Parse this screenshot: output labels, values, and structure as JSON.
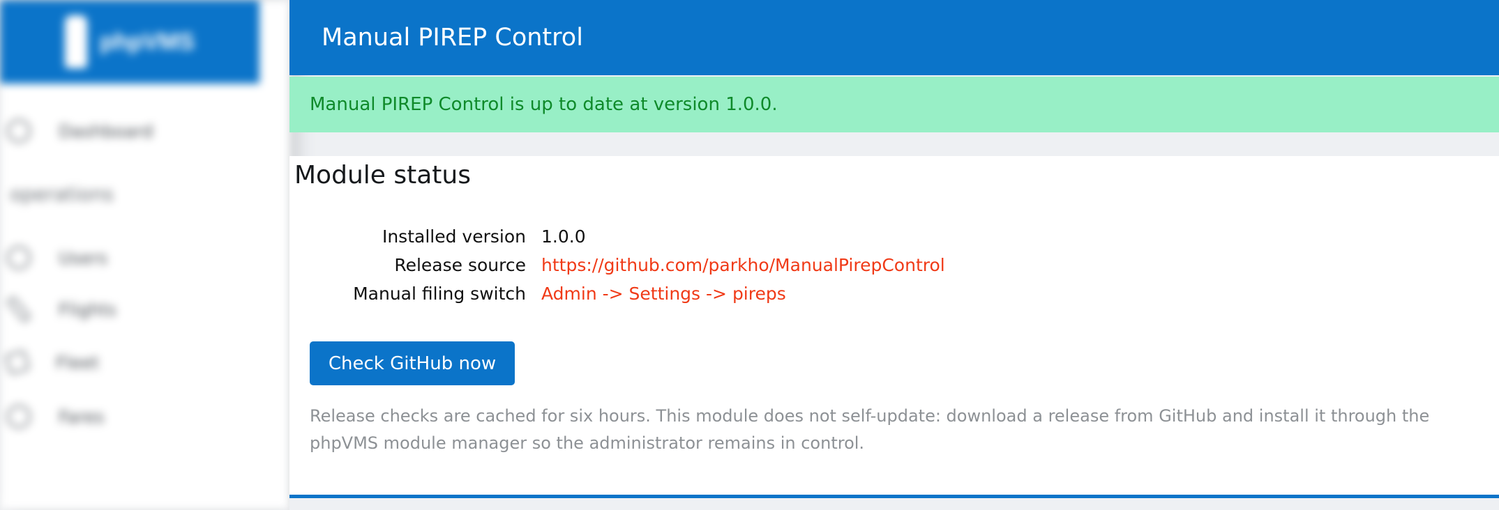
{
  "sidebar": {
    "brand": "phpVMS",
    "items": [
      {
        "label": "Dashboard",
        "icon": "dashboard-icon"
      },
      {
        "label": "Users",
        "icon": "user-icon"
      },
      {
        "label": "Flights",
        "icon": "pencil-icon"
      },
      {
        "label": "Fleet",
        "icon": "tag-icon"
      },
      {
        "label": "Fares",
        "icon": "circle-icon"
      }
    ],
    "section_label": "operations"
  },
  "header": {
    "title": "Manual PIREP Control"
  },
  "alert": {
    "message": "Manual PIREP Control is up to date at version 1.0.0."
  },
  "module_status": {
    "title": "Module status",
    "rows": [
      {
        "label": "Installed version",
        "value": "1.0.0"
      },
      {
        "label": "Release source",
        "value": "https://github.com/parkho/ManualPirepControl"
      },
      {
        "label": "Manual filing switch",
        "value": "Admin -> Settings -> pireps"
      }
    ],
    "check_button": "Check GitHub now",
    "help_text": "Release checks are cached for six hours. This module does not self-update: download a release from GitHub and install it through the phpVMS module manager so the administrator remains in control."
  },
  "colors": {
    "primary": "#0b74c9",
    "success_bg": "#98efc6",
    "success_text": "#0f8a2a",
    "link": "#f03a17",
    "muted": "#8d9195"
  }
}
